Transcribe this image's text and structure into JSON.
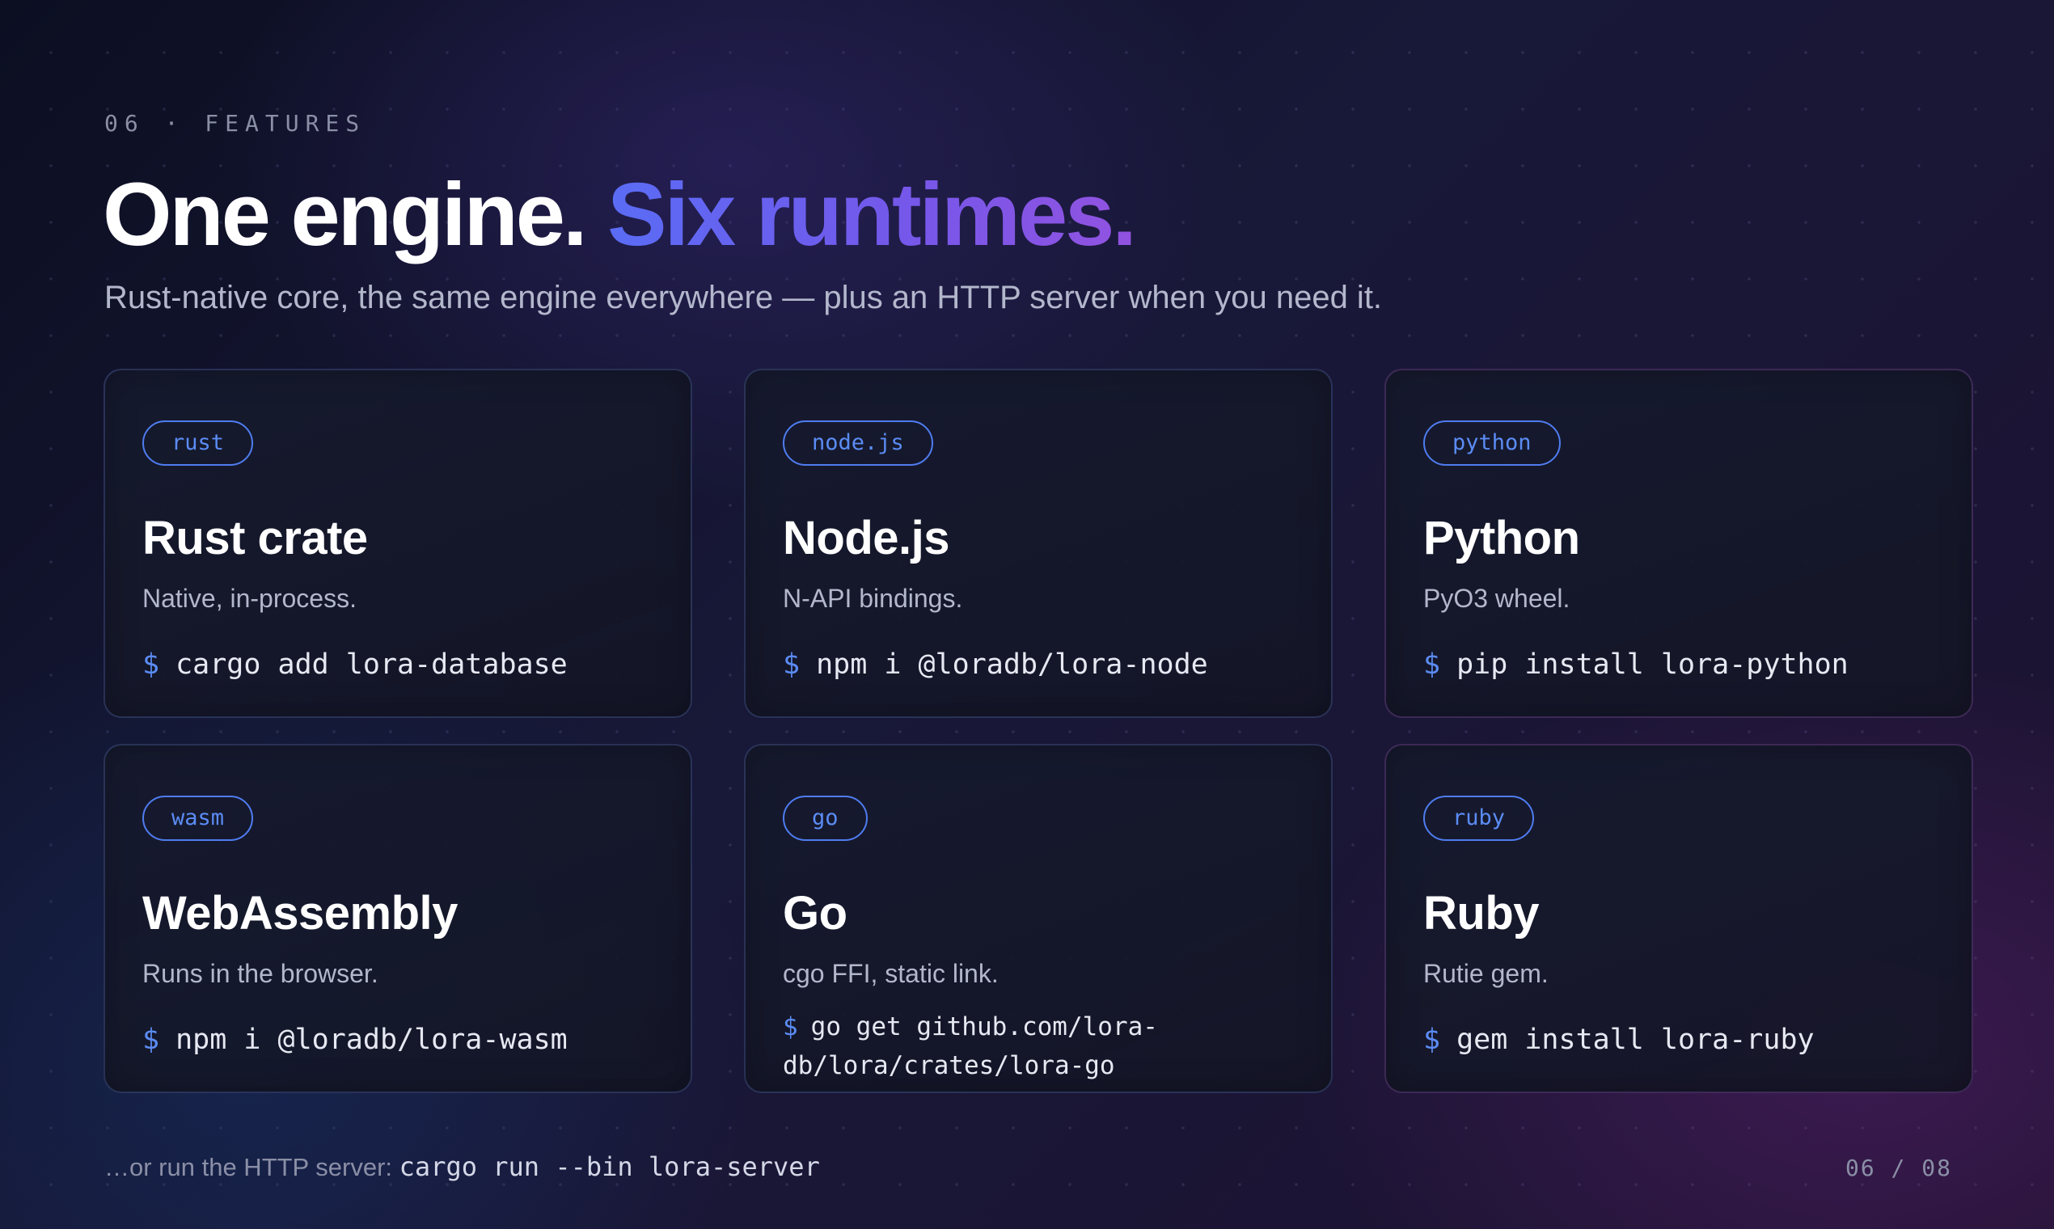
{
  "slide": {
    "eyebrow": "06 · FEATURES",
    "headline_main": "One engine.",
    "headline_accent": "Six runtimes.",
    "subtitle": "Rust-native core, the same engine everywhere — plus an HTTP server when you need it.",
    "footer_label": "…or run the HTTP server:",
    "footer_command": "cargo run --bin lora-server",
    "page_number": "06 / 08"
  },
  "prompt_symbol": "$",
  "cards": [
    {
      "tag": "rust",
      "title": "Rust crate",
      "desc": "Native, in-process.",
      "cmd": "cargo add lora-database"
    },
    {
      "tag": "node.js",
      "title": "Node.js",
      "desc": "N-API bindings.",
      "cmd": "npm i @loradb/lora-node"
    },
    {
      "tag": "python",
      "title": "Python",
      "desc": "PyO3 wheel.",
      "cmd": "pip install lora-python"
    },
    {
      "tag": "wasm",
      "title": "WebAssembly",
      "desc": "Runs in the browser.",
      "cmd": "npm i @loradb/lora-wasm"
    },
    {
      "tag": "go",
      "title": "Go",
      "desc": "cgo FFI, static link.",
      "cmd": "go get github.com/lora-db/lora/crates/lora-go"
    },
    {
      "tag": "ruby",
      "title": "Ruby",
      "desc": "Rutie gem.",
      "cmd": "gem install lora-ruby"
    }
  ],
  "colors": {
    "accent_blue": "#5b8cf5",
    "accent_violet": "#7458ea",
    "headline": "#ffffff",
    "muted_text": "#b3b7cc",
    "background": "#12142a"
  }
}
